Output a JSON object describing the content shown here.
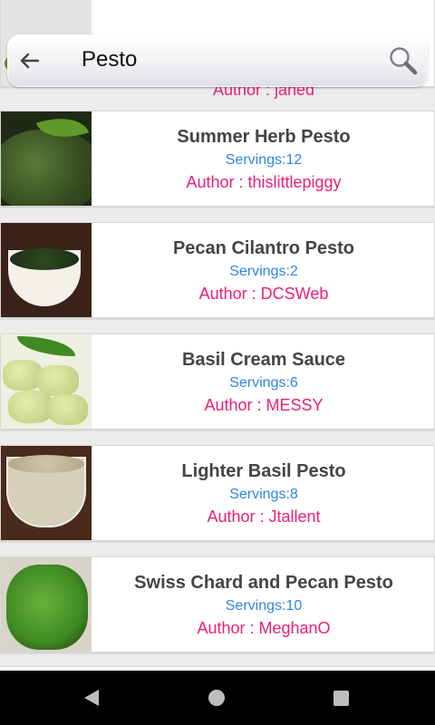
{
  "search": {
    "query": "Pesto"
  },
  "partial_item": {
    "author": "Author : janed"
  },
  "recipes": [
    {
      "title": "Summer Herb Pesto",
      "servings": "Servings:12",
      "author": "Author : thislittlepiggy"
    },
    {
      "title": "Pecan Cilantro Pesto",
      "servings": "Servings:2",
      "author": "Author : DCSWeb"
    },
    {
      "title": "Basil Cream Sauce",
      "servings": "Servings:6",
      "author": "Author : MESSY"
    },
    {
      "title": "Lighter Basil Pesto",
      "servings": "Servings:8",
      "author": "Author : Jtallent"
    },
    {
      "title": "Swiss Chard and Pecan Pesto",
      "servings": "Servings:10",
      "author": "Author : MeghanO"
    }
  ],
  "icons": {
    "back": "back-arrow-icon",
    "search": "magnifier-icon",
    "nav_back": "triangle-back-icon",
    "nav_home": "circle-home-icon",
    "nav_recent": "square-recent-icon"
  },
  "colors": {
    "title": "#444444",
    "servings": "#2f86e3",
    "author": "#ee1e77"
  }
}
